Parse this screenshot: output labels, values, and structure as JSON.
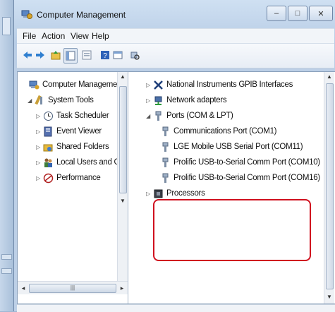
{
  "window": {
    "title": "Computer Management",
    "buttons": {
      "minimize": "–",
      "maximize": "□",
      "close": "✕"
    }
  },
  "menu": [
    "File",
    "Action",
    "View",
    "Help"
  ],
  "toolbar": {
    "icons": [
      "back-arrow-icon",
      "forward-arrow-icon",
      "up-folder-icon",
      "show-hide-tree-icon",
      "properties-icon",
      "help-icon",
      "show-console-icon",
      "scan-hardware-icon"
    ]
  },
  "tree": {
    "items": [
      {
        "label": "Computer Management (Lc",
        "icon": "computer-management-icon",
        "expander": ""
      },
      {
        "label": "System Tools",
        "icon": "system-tools-icon",
        "expander": "◢"
      },
      {
        "label": "Task Scheduler",
        "icon": "clock-icon",
        "expander": "▷"
      },
      {
        "label": "Event Viewer",
        "icon": "event-viewer-icon",
        "expander": "▷"
      },
      {
        "label": "Shared Folders",
        "icon": "shared-folders-icon",
        "expander": "▷"
      },
      {
        "label": "Local Users and Grou",
        "icon": "users-icon",
        "expander": "▷"
      },
      {
        "label": "Performance",
        "icon": "performance-icon",
        "expander": "▷"
      }
    ],
    "hscroll_thumb": "|||"
  },
  "devices": {
    "items": [
      {
        "label": "National Instruments GPIB Interfaces",
        "icon": "gpib-icon",
        "expander": "▷"
      },
      {
        "label": "Network adapters",
        "icon": "network-adapter-icon",
        "expander": "▷"
      },
      {
        "label": "Ports (COM & LPT)",
        "icon": "port-icon",
        "expander": "◢"
      },
      {
        "label": "Communications Port (COM1)",
        "icon": "port-icon",
        "expander": ""
      },
      {
        "label": "LGE Mobile USB Serial Port (COM11)",
        "icon": "port-icon",
        "expander": ""
      },
      {
        "label": "Prolific USB-to-Serial Comm Port (COM10)",
        "icon": "port-icon",
        "expander": ""
      },
      {
        "label": "Prolific USB-to-Serial Comm Port (COM16)",
        "icon": "port-icon",
        "expander": ""
      },
      {
        "label": "Processors",
        "icon": "processor-icon",
        "expander": "▷"
      }
    ]
  },
  "colors": {
    "highlight": "#d0101e",
    "title_bar": "#c4d6ec"
  }
}
